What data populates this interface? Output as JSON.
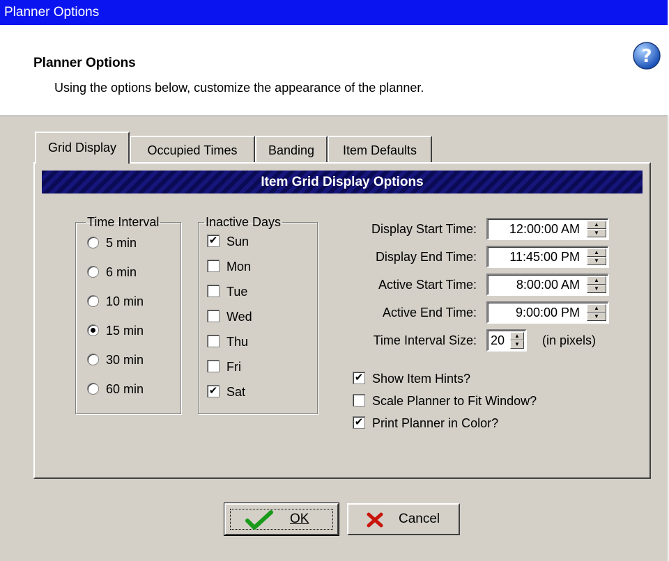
{
  "window": {
    "title": "Planner Options"
  },
  "header": {
    "title": "Planner Options",
    "subtitle": "Using the options below, customize the appearance of the planner."
  },
  "tabs": [
    {
      "label": "Grid Display",
      "active": true
    },
    {
      "label": "Occupied Times",
      "active": false
    },
    {
      "label": "Banding",
      "active": false
    },
    {
      "label": "Item Defaults",
      "active": false
    }
  ],
  "banner": "Item Grid Display Options",
  "time_interval": {
    "label": "Time Interval",
    "options": [
      "5 min",
      "6 min",
      "10 min",
      "15 min",
      "30 min",
      "60 min"
    ],
    "selected": "15 min"
  },
  "inactive_days": {
    "label": "Inactive Days",
    "days": [
      {
        "label": "Sun",
        "checked": true
      },
      {
        "label": "Mon",
        "checked": false
      },
      {
        "label": "Tue",
        "checked": false
      },
      {
        "label": "Wed",
        "checked": false
      },
      {
        "label": "Thu",
        "checked": false
      },
      {
        "label": "Fri",
        "checked": false
      },
      {
        "label": "Sat",
        "checked": true
      }
    ]
  },
  "times": {
    "display_start": {
      "label": "Display Start Time:",
      "value": "12:00:00 AM"
    },
    "display_end": {
      "label": "Display End Time:",
      "value": "11:45:00 PM"
    },
    "active_start": {
      "label": "Active Start Time:",
      "value": "8:00:00 AM"
    },
    "active_end": {
      "label": "Active End Time:",
      "value": "9:00:00 PM"
    }
  },
  "interval_size": {
    "label": "Time Interval Size:",
    "value": "20",
    "unit": "(in pixels)"
  },
  "options": [
    {
      "label": "Show Item Hints?",
      "checked": true
    },
    {
      "label": "Scale Planner to Fit Window?",
      "checked": false
    },
    {
      "label": "Print Planner in Color?",
      "checked": true
    }
  ],
  "buttons": {
    "ok": "OK",
    "cancel": "Cancel"
  },
  "colors": {
    "titlebar": "#0a14f0",
    "face": "#d4d0c8",
    "banner": "#0a0a55"
  }
}
